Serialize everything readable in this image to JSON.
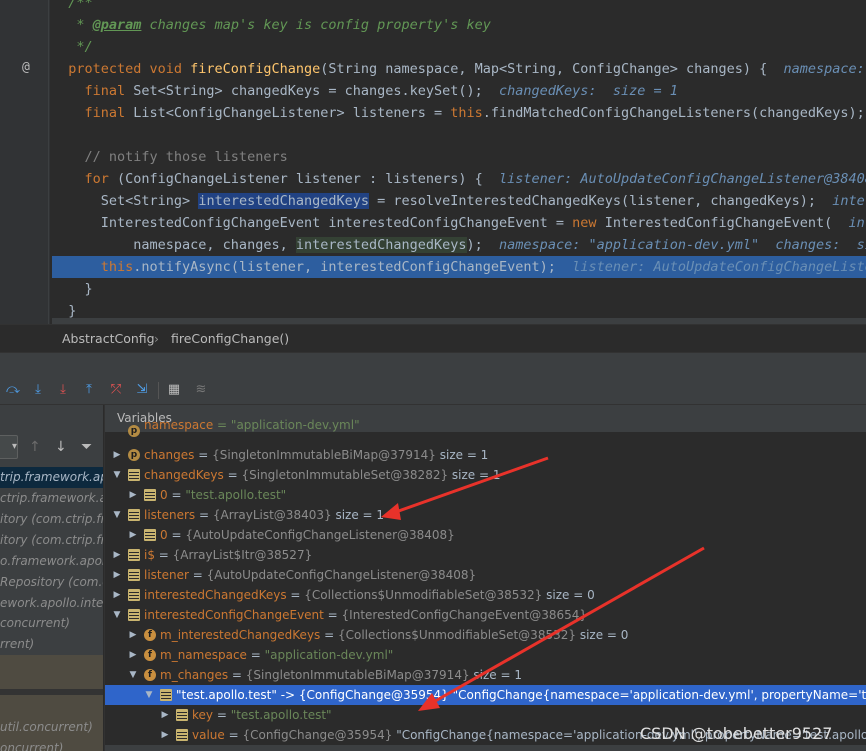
{
  "editor": {
    "lines": [
      {
        "segments": [
          {
            "c": "doc",
            "t": "  /**"
          }
        ]
      },
      {
        "segments": [
          {
            "c": "doc",
            "t": "   * "
          },
          {
            "c": "doctag",
            "t": "@param"
          },
          {
            "c": "doc",
            "t": " changes map's key is config property's key"
          }
        ]
      },
      {
        "segments": [
          {
            "c": "doc",
            "t": "   */"
          }
        ]
      },
      {
        "segments": [
          {
            "c": "kw",
            "t": "  protected void "
          },
          {
            "c": "fn",
            "t": "fireConfigChange"
          },
          {
            "c": "",
            "t": "(String namespace, Map<String, ConfigChange> changes) {  "
          },
          {
            "c": "hint",
            "t": "namespace: \"a"
          }
        ]
      },
      {
        "segments": [
          {
            "c": "kw",
            "t": "    final "
          },
          {
            "c": "",
            "t": "Set<String> changedKeys = changes.keySet();  "
          },
          {
            "c": "hint",
            "t": "changedKeys:  size = 1"
          }
        ]
      },
      {
        "segments": [
          {
            "c": "kw",
            "t": "    final "
          },
          {
            "c": "",
            "t": "List<ConfigChangeListener> listeners = "
          },
          {
            "c": "kw",
            "t": "this"
          },
          {
            "c": "",
            "t": ".findMatchedConfigChangeListeners(changedKeys);  li"
          }
        ]
      },
      {
        "segments": [
          {
            "c": "",
            "t": ""
          }
        ]
      },
      {
        "segments": [
          {
            "c": "cm",
            "t": "    // notify those listeners"
          }
        ]
      },
      {
        "segments": [
          {
            "c": "kw",
            "t": "    for "
          },
          {
            "c": "",
            "t": "(ConfigChangeListener listener : listeners) {  "
          },
          {
            "c": "hint",
            "t": "listener: AutoUpdateConfigChangeListener@38408"
          }
        ]
      },
      {
        "segments": [
          {
            "c": "",
            "t": "      Set<String> "
          },
          {
            "c": "hl-wr",
            "t": "interestedChangedKeys"
          },
          {
            "c": "",
            "t": " = resolveInterestedChangedKeys(listener, changedKeys);  "
          },
          {
            "c": "hint",
            "t": "interes"
          }
        ]
      },
      {
        "segments": [
          {
            "c": "",
            "t": "      InterestedConfigChangeEvent interestedConfigChangeEvent = "
          },
          {
            "c": "kw",
            "t": "new "
          },
          {
            "c": "",
            "t": "InterestedConfigChangeEvent(  "
          },
          {
            "c": "hint",
            "t": "inte"
          }
        ]
      },
      {
        "segments": [
          {
            "c": "",
            "t": "          namespace, changes, "
          },
          {
            "c": "hl-rd",
            "t": "interestedChangedKeys"
          },
          {
            "c": "",
            "t": ");  "
          },
          {
            "c": "hint",
            "t": "namespace: \"application-dev.yml\"  changes:  si"
          }
        ]
      },
      {
        "segments": [
          {
            "c": "kw",
            "t": "      this"
          },
          {
            "c": "",
            "t": ".notifyAsync(listener, interestedConfigChangeEvent);  "
          },
          {
            "c": "hint",
            "t": "listener: AutoUpdateConfigChangeListe"
          }
        ]
      },
      {
        "segments": [
          {
            "c": "",
            "t": "    }"
          }
        ]
      },
      {
        "segments": [
          {
            "c": "",
            "t": "  }"
          }
        ]
      }
    ],
    "gutter_marker": "@"
  },
  "breadcrumb": {
    "class": "AbstractConfig",
    "method": "fireConfigChange()",
    "separator": "›"
  },
  "frames": [
    "trip.framework.apol",
    "ctrip.framework.a",
    "itory (com.ctrip.fr",
    "itory (com.ctrip.fr",
    "o.framework.apollo",
    "Repository (com.c",
    "ework.apollo.intern",
    "concurrent)",
    "rrent)",
    "",
    "",
    "",
    "util.concurrent)",
    "oncurrent)"
  ],
  "variables": {
    "header": "Variables",
    "rows": [
      {
        "indent": 0,
        "exp": "none",
        "icon": "p",
        "name": "namespace",
        "val": " = \"application-dev.yml\"",
        "type": "str",
        "partial": true
      },
      {
        "indent": 0,
        "exp": "closed",
        "icon": "p",
        "name": "changes",
        "obj": "{SingletonImmutableBiMap@37914}",
        "size": "size = 1"
      },
      {
        "indent": 0,
        "exp": "open",
        "icon": "field",
        "name": "changedKeys",
        "obj": "{SingletonImmutableSet@38282}",
        "size": "size = 1"
      },
      {
        "indent": 1,
        "exp": "closed",
        "icon": "field",
        "name": "0",
        "val": "\"test.apollo.test\"",
        "type": "str"
      },
      {
        "indent": 0,
        "exp": "open",
        "icon": "field",
        "name": "listeners",
        "obj": "{ArrayList@38403}",
        "size": "size = 1"
      },
      {
        "indent": 1,
        "exp": "closed",
        "icon": "field",
        "name": "0",
        "obj": "{AutoUpdateConfigChangeListener@38408}"
      },
      {
        "indent": 0,
        "exp": "closed",
        "icon": "field",
        "name": "i$",
        "obj": "{ArrayList$Itr@38527}"
      },
      {
        "indent": 0,
        "exp": "closed",
        "icon": "field",
        "name": "listener",
        "obj": "{AutoUpdateConfigChangeListener@38408}"
      },
      {
        "indent": 0,
        "exp": "closed",
        "icon": "field",
        "name": "interestedChangedKeys",
        "obj": "{Collections$UnmodifiableSet@38532}",
        "size": "size = 0"
      },
      {
        "indent": 0,
        "exp": "open",
        "icon": "field",
        "name": "interestedConfigChangeEvent",
        "obj": "{InterestedConfigChangeEvent@38654}"
      },
      {
        "indent": 1,
        "exp": "closed",
        "icon": "f",
        "name": "m_interestedChangedKeys",
        "obj": "{Collections$UnmodifiableSet@38532}",
        "size": "size = 0"
      },
      {
        "indent": 1,
        "exp": "closed",
        "icon": "f",
        "name": "m_namespace",
        "val": "\"application-dev.yml\"",
        "type": "str"
      },
      {
        "indent": 1,
        "exp": "open",
        "icon": "f",
        "name": "m_changes",
        "obj": "{SingletonImmutableBiMap@37914}",
        "size": "size = 1"
      },
      {
        "indent": 2,
        "exp": "open",
        "icon": "field",
        "name": "\"test.apollo.test\"",
        "obj": "-> {ConfigChange@35954}",
        "tail": "\"ConfigChange{namespace='application-dev.yml', propertyName='test.ap",
        "sel": true
      },
      {
        "indent": 3,
        "exp": "closed",
        "icon": "field",
        "name": "key",
        "val": "\"test.apollo.test\"",
        "type": "str"
      },
      {
        "indent": 3,
        "exp": "closed",
        "icon": "field",
        "name": "value",
        "obj": "{ConfigChange@35954}",
        "tail": "\"ConfigChange{namespace='application-dev.yml', propertyName='test.apollo.test',"
      }
    ]
  },
  "toolbar": {
    "icons": [
      "step-over-icon",
      "step-into-icon",
      "force-step-into-icon",
      "step-out-icon",
      "drop-frame-icon",
      "run-to-cursor-icon",
      "evaluate-expression-icon",
      "trace-current-stream-icon"
    ]
  },
  "frames_toolbar": {
    "icons": [
      "filter-dropdown-icon",
      "up-arrow-icon",
      "down-arrow-icon",
      "funnel-icon"
    ]
  },
  "watermark": "CSDN @tobebetter9527",
  "colors": {
    "arrow": "#e8322a",
    "selection": "#2f65ca",
    "editor_bg": "#2b2b2b"
  }
}
